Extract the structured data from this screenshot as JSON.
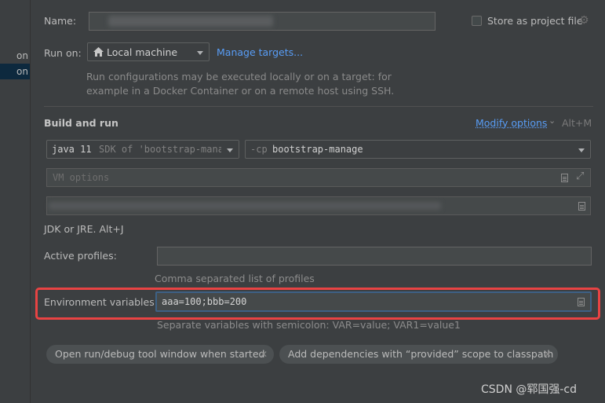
{
  "sidebar": {
    "items": [
      {
        "label": "on"
      },
      {
        "label": "on"
      }
    ]
  },
  "name_row": {
    "label": "Name:",
    "value": "",
    "store_label": "Store as project file",
    "store_checked": false
  },
  "run_on": {
    "label": "Run on:",
    "target_value": "Local machine",
    "manage_link": "Manage targets...",
    "description_line1": "Run configurations may be executed locally or on a target: for",
    "description_line2": "example in a Docker Container or on a remote host using SSH."
  },
  "build_and_run": {
    "title": "Build and run",
    "modify_options": "Modify options",
    "modify_shortcut": "Alt+M",
    "jdk_select": {
      "value": "java 11",
      "secondary": "SDK of 'bootstrap-manag"
    },
    "classpath_select": {
      "prefix": "-cp",
      "value": "bootstrap-manage"
    },
    "vm_options_placeholder": "VM options",
    "main_class_value": "",
    "jdk_hint": "JDK or JRE. Alt+J"
  },
  "active_profiles": {
    "label": "Active profiles:",
    "value": "",
    "hint": "Comma separated list of profiles"
  },
  "environment_variables": {
    "label": "Environment variables:",
    "value": "aaa=100;bbb=200",
    "hint": "Separate variables with semicolon: VAR=value; VAR1=value1"
  },
  "chips": [
    {
      "label": "Open run/debug tool window when started"
    },
    {
      "label": "Add dependencies with “provided” scope to classpath"
    }
  ],
  "watermark": "CSDN @郓国强-cd",
  "colors": {
    "highlight": "#e84343",
    "accent": "#589df6",
    "focus": "#3d6185"
  }
}
